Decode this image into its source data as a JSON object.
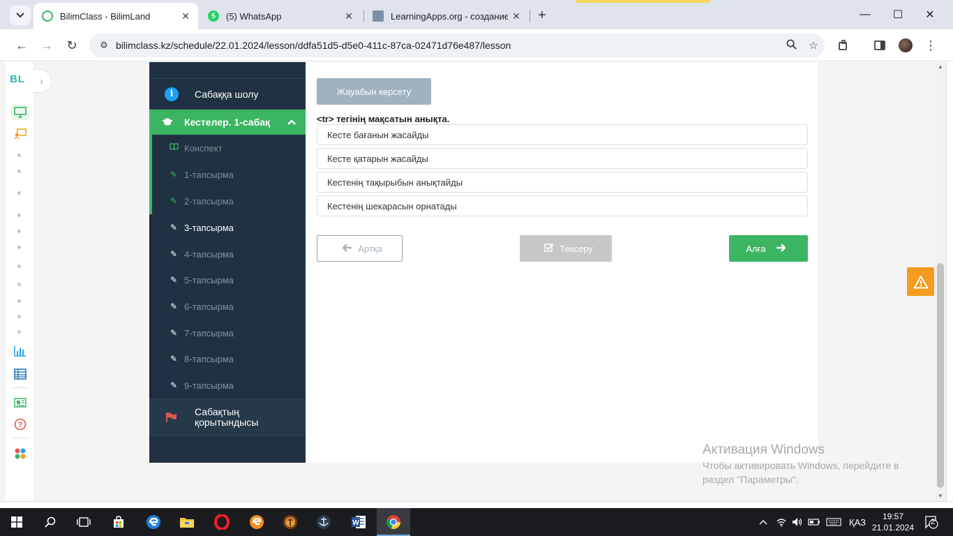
{
  "browser": {
    "tabs": [
      {
        "title": "BilimClass - BilimLand",
        "active": true
      },
      {
        "title": "(5) WhatsApp",
        "badge": "5",
        "active": false
      },
      {
        "title": "LearningApps.org - создание м",
        "active": false
      }
    ],
    "new_tab": "+",
    "window_controls": {
      "minimize": "—",
      "maximize": "☐",
      "close": "✕"
    },
    "url": "bilimclass.kz/schedule/22.01.2024/lesson/ddfa51d5-d5e0-411c-87ca-02471d76e487/lesson",
    "icons": {
      "back": "←",
      "forward": "→",
      "reload": "↻",
      "site_info": "⚙",
      "zoom": "🔍",
      "bookmark": "☆",
      "extensions": "⧉",
      "side_panel": "◧",
      "menu": "⋮"
    }
  },
  "rail": {
    "logo": "BL",
    "toggle": "›",
    "icons": [
      "monitor-icon",
      "teacher-board-icon",
      "bar-chart-icon",
      "table-icon",
      "news-icon",
      "help-icon",
      "apps-icon"
    ]
  },
  "lesson_sidebar": {
    "overview_label": "Сабаққа шолу",
    "section_label": "Кестелер. 1-сабақ",
    "items": [
      {
        "label": "Конспект",
        "state": "done",
        "icon": "book-icon"
      },
      {
        "label": "1-тапсырма",
        "state": "done",
        "icon": "edit-icon"
      },
      {
        "label": "2-тапсырма",
        "state": "done",
        "icon": "edit-icon"
      },
      {
        "label": "3-тапсырма",
        "state": "current",
        "icon": "edit-icon"
      },
      {
        "label": "4-тапсырма",
        "state": "pending",
        "icon": "edit-icon"
      },
      {
        "label": "5-тапсырма",
        "state": "pending",
        "icon": "edit-icon"
      },
      {
        "label": "6-тапсырма",
        "state": "pending",
        "icon": "edit-icon"
      },
      {
        "label": "7-тапсырма",
        "state": "pending",
        "icon": "edit-icon"
      },
      {
        "label": "8-тапсырма",
        "state": "pending",
        "icon": "edit-icon"
      },
      {
        "label": "9-тапсырма",
        "state": "pending",
        "icon": "edit-icon"
      }
    ],
    "summary_label_line1": "Сабақтың",
    "summary_label_line2": "қорытындысы"
  },
  "task": {
    "show_answer_label": "Жауабын көрсету",
    "question": "<tr> тегінің мақсатын анықта.",
    "options": [
      "Кесте бағанын жасайды",
      "Кесте қатарын жасайды",
      "Кестенің тақырыбын анықтайды",
      "Кестенің шекарасын орнатады"
    ],
    "back_label": "Артқа",
    "check_label": "Тексеру",
    "next_label": "Алға"
  },
  "watermark": {
    "title": "Активация Windows",
    "text": "Чтобы активировать Windows, перейдите в раздел \"Параметры\"."
  },
  "taskbar": {
    "language": "ҚАЗ",
    "time": "19:57",
    "date": "21.01.2024",
    "notifications": "2"
  },
  "colors": {
    "sidebar_bg": "#1f3142",
    "accent_green": "#3cb563",
    "show_answer_bg": "#9fb2c1",
    "alert_orange": "#f39c1f"
  }
}
